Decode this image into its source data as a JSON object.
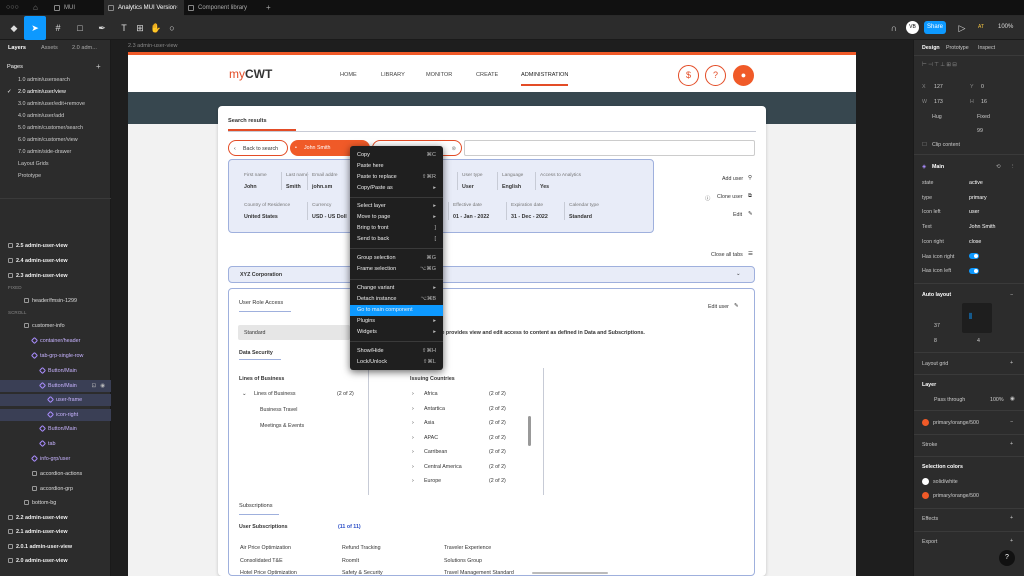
{
  "titlebar": {
    "tabs": [
      {
        "label": "MUI"
      },
      {
        "label": "Analytics MUI Version"
      },
      {
        "label": "Component library"
      }
    ],
    "new_tab": "+"
  },
  "toolbar": {
    "share": "Share",
    "zoom": "100%",
    "avatar": "VB",
    "avatar2": "AT"
  },
  "left_panel": {
    "tabs": [
      "Layers",
      "Assets",
      "2.0 adm..."
    ],
    "pages_title": "Pages",
    "pages": [
      "1.0 admin/usersearch",
      "2.0 admin/user/view",
      "3.0 admin/user/edit+remove",
      "4.0 admin/user/add",
      "5.0 admin/customer/search",
      "6.0 admin/customer/view",
      "7.0 admin/side-drawer",
      "Layout Grids",
      "Prototype"
    ],
    "layers": [
      "2.5 admin-user-view",
      "2.4 admin-user-view",
      "2.3 admin-user-view",
      "FIXED",
      "header/fmsin-1299",
      "SCROLL",
      "customer-info",
      "container/header",
      "tab-grp-single-row",
      "Button/Main",
      "Button/Main",
      "user-frame",
      "icon-right",
      "Button/Main",
      "tab",
      "info-grp/user",
      "accordion-actions",
      "accordion-grp",
      "bottom-bg",
      "2.2 admin-user-view",
      "2.1 admin-user-view",
      "2.0.1 admin-user-view",
      "2.0 admin-user-view"
    ]
  },
  "canvas": {
    "frame_label": "2.3 admin-user-view",
    "logo_prefix": "my",
    "logo_suffix": "CWT",
    "nav": [
      "HOME",
      "LIBRARY",
      "MONITOR",
      "CREATE",
      "ADMINISTRATION"
    ],
    "icons": {
      "dollar": "$",
      "help": "?"
    },
    "search_results": "Search results",
    "back": "Back to search",
    "user_chip": "John Smith",
    "user_info": [
      {
        "label": "First name",
        "value": "John"
      },
      {
        "label": "Last name",
        "value": "Smith"
      },
      {
        "label": "Email addre",
        "value": "john.sm"
      },
      {
        "label": "User type",
        "value": "User"
      },
      {
        "label": "Language",
        "value": "English"
      },
      {
        "label": "Access to Analytics",
        "value": "Yes"
      },
      {
        "label": "Country of Residence",
        "value": "United States"
      },
      {
        "label": "Currency",
        "value": "USD - US Doll"
      },
      {
        "label": "Effective date",
        "value": "01 - Jan - 2022"
      },
      {
        "label": "Expiration date",
        "value": "31 - Dec - 2022"
      },
      {
        "label": "Calendar type",
        "value": "Standard"
      }
    ],
    "actions": [
      "Add user",
      "Clone user",
      "Edit"
    ],
    "close_tabs": "Close all tabs",
    "corp": "XYZ Corporation",
    "role_access": "User Role Access",
    "edit_user": "Edit user",
    "role_value": "Standard",
    "role_desc": "le provides view and edit access to content as defined in Data and Subscriptions.",
    "data_security": "Data Security",
    "lob_title": "Lines of Business",
    "lob_item": "Lines of Business",
    "lob_count": "(2 of 2)",
    "lob_children": [
      "Business Travel",
      "Meetings & Events"
    ],
    "issuing_title": "Issuing Countries",
    "countries": [
      {
        "name": "Africa",
        "count": "(2 of 2)"
      },
      {
        "name": "Antartica",
        "count": "(2 of 2)"
      },
      {
        "name": "Asia",
        "count": "(2 of 2)"
      },
      {
        "name": "APAC",
        "count": "(2 of 2)"
      },
      {
        "name": "Carribean",
        "count": "(2 of 2)"
      },
      {
        "name": "Central America",
        "count": "(2 of 2)"
      },
      {
        "name": "Europe",
        "count": "(2 of 2)"
      }
    ],
    "subscriptions": "Subscriptions",
    "user_subs": "User Subscriptions",
    "subs_count": "(11 of 11)",
    "subs": [
      "Air Price Optimization",
      "Refund Tracking",
      "Traveler Experience",
      "Consolidated T&E",
      "RoomIt",
      "Solutions Group",
      "Hotel Price Optimization",
      "Safety & Security",
      "Travel Management Standard"
    ]
  },
  "context_menu": [
    {
      "label": "Copy",
      "shortcut": "⌘C"
    },
    {
      "label": "Paste here",
      "shortcut": ""
    },
    {
      "label": "Paste to replace",
      "shortcut": "⇧⌘R"
    },
    {
      "label": "Copy/Paste as",
      "shortcut": "▸"
    },
    {
      "label": "Select layer",
      "shortcut": "▸"
    },
    {
      "label": "Move to page",
      "shortcut": "▸"
    },
    {
      "label": "Bring to front",
      "shortcut": "]"
    },
    {
      "label": "Send to back",
      "shortcut": "["
    },
    {
      "label": "Group selection",
      "shortcut": "⌘G"
    },
    {
      "label": "Frame selection",
      "shortcut": "⌥⌘G"
    },
    {
      "label": "Change variant",
      "shortcut": "▸"
    },
    {
      "label": "Detach instance",
      "shortcut": "⌥⌘B"
    },
    {
      "label": "Go to main component",
      "shortcut": ""
    },
    {
      "label": "Plugins",
      "shortcut": "▸"
    },
    {
      "label": "Widgets",
      "shortcut": "▸"
    },
    {
      "label": "Show/Hide",
      "shortcut": "⇧⌘H"
    },
    {
      "label": "Lock/Unlock",
      "shortcut": "⇧⌘L"
    }
  ],
  "right_panel": {
    "tabs": [
      "Design",
      "Prototype",
      "Inspect"
    ],
    "x": "127",
    "y": "0",
    "w": "173",
    "h": "Fixed",
    "hug": "Hug",
    "h_val": "16",
    "radius": "99",
    "clip": "Clip content",
    "component": "Main",
    "props": [
      {
        "label": "state",
        "value": "active"
      },
      {
        "label": "type",
        "value": "primary"
      },
      {
        "label": "Icon left",
        "value": "user"
      },
      {
        "label": "Text",
        "value": "John Smith"
      },
      {
        "label": "Icon right",
        "value": "close"
      },
      {
        "label": "Has icon right",
        "value": ""
      },
      {
        "label": "Has icon left",
        "value": ""
      }
    ],
    "auto_layout": "Auto layout",
    "gap": "37",
    "pad_h": "8",
    "pad_v": "4",
    "layout_grid": "Layout grid",
    "layer": "Layer",
    "pass": "Pass through",
    "opacity": "100%",
    "fill": "primary/orange/500",
    "stroke": "Stroke",
    "sel_colors": "Selection colors",
    "c1": "solid/white",
    "c2": "primary/orange/500",
    "effects": "Effects",
    "export": "Export",
    "help": "?"
  },
  "colors": {
    "accent": "#0d99ff",
    "brand": "#f05a28",
    "band": "#37474f"
  }
}
